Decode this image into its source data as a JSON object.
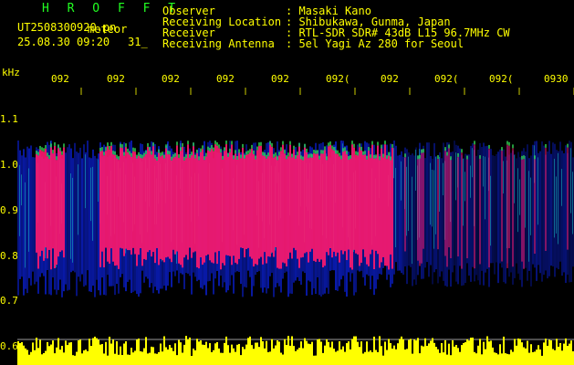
{
  "app_title": "H R O F F T",
  "file_name": "UT2508300920.pn",
  "meteor_label": "meteor",
  "datetime": "25.08.30 09:20",
  "counter": "31_",
  "info": [
    {
      "label": "Observer",
      "value": ": Masaki Kano"
    },
    {
      "label": "Receiving Location",
      "value": ": Shibukawa, Gunma, Japan"
    },
    {
      "label": "Receiver",
      "value": ": RTL-SDR SDR# 43dB L15 96.7MHz CW"
    },
    {
      "label": "Receiving Antenna",
      "value": ": 5el Yagi Az 280 for Seoul"
    }
  ],
  "y_unit": "kHz",
  "y_ticks": [
    "1.1",
    "1.0",
    "0.9",
    "0.8",
    "0.7",
    "0.6"
  ],
  "x_ticks": [
    "092",
    "092",
    "092",
    "092",
    "092",
    "092(",
    "092",
    "092(",
    "092(",
    "0930"
  ],
  "colors": {
    "text": "#ffff00",
    "title": "#22ff22",
    "background": "#000000",
    "echo": "#ff1a6e",
    "noise": "#0a1ec8",
    "power": "#ffff00"
  }
}
